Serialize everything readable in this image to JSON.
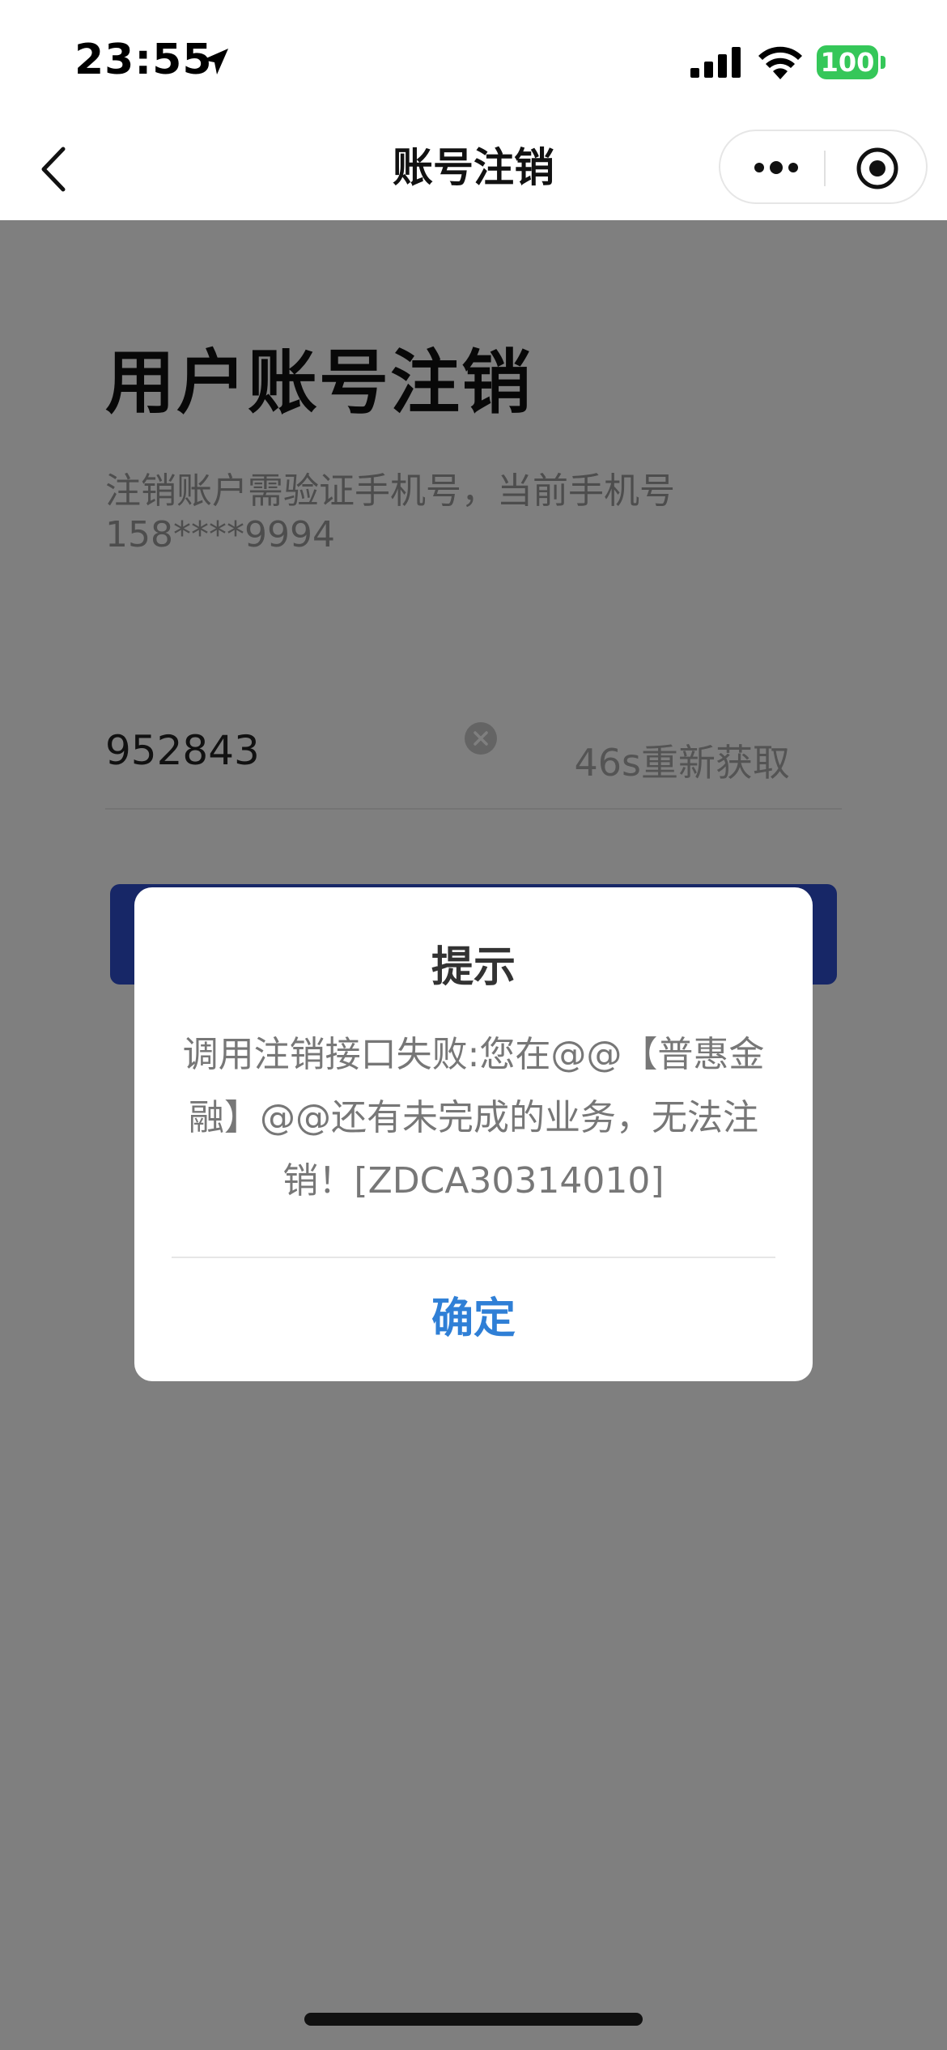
{
  "status_bar": {
    "time": "23:55",
    "battery": "100",
    "battery_color": "#35c759",
    "icons": [
      "location-arrow-icon",
      "signal-icon",
      "wifi-icon"
    ]
  },
  "nav": {
    "title": "账号注销",
    "icons": [
      "back-icon",
      "more-icon",
      "record-icon"
    ]
  },
  "page": {
    "title": "用户账号注销",
    "description": "注销账户需验证手机号，当前手机号158****9994",
    "code_value": "952843",
    "resend_label": "46s重新获取",
    "submit_color": "#2f4fcf"
  },
  "dialog": {
    "title": "提示",
    "message": "调用注销接口失败:您在@@【普惠金融】@@还有未完成的业务，无法注销！[ZDCA30314010]",
    "confirm_label": "确定",
    "confirm_color": "#2f7fd6"
  }
}
